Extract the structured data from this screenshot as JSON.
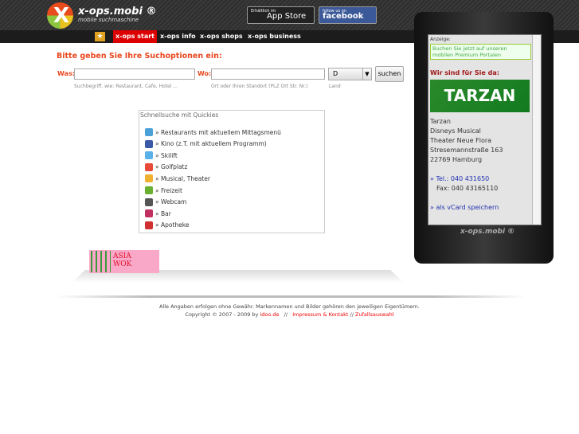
{
  "header": {
    "brand": "x-ops.mobi ®",
    "tagline": "mobile suchmaschine",
    "appstore": "App Store",
    "appstore_small": "Erhältlich im",
    "facebook": "facebook",
    "facebook_small": "follow us on"
  },
  "nav": [
    {
      "label": "x-ops start",
      "active": true
    },
    {
      "label": "x-ops info"
    },
    {
      "label": "x-ops shops"
    },
    {
      "label": "x-ops business"
    }
  ],
  "search": {
    "title": "Bitte geben Sie Ihre Suchoptionen ein:",
    "was_label": "Was:",
    "was_value": "",
    "was_hint": "Suchbegriff, wie: Restaurant, Cafe, Hotel ...",
    "wo_label": "Wo:",
    "wo_value": "",
    "wo_hint": "Ort oder Ihren Standort (PLZ Ort Str. Nr.)",
    "land_value": "D",
    "land_hint": "Land",
    "button": "suchen"
  },
  "quickies": {
    "title": "Schnellsuche mit Quickies",
    "items": [
      {
        "label": "» Restaurants mit aktuellem Mittagsmenü",
        "color": "#4aa0d8"
      },
      {
        "label": "» Kino (z.T. mit aktuellem Programm)",
        "color": "#3a5aa8"
      },
      {
        "label": "» Skilift",
        "color": "#5ab0e8"
      },
      {
        "label": "» Golfplatz",
        "color": "#e84a3a"
      },
      {
        "label": "» Musical, Theater",
        "color": "#f0b030"
      },
      {
        "label": "» Freizeit",
        "color": "#6ab030"
      },
      {
        "label": "» Webcam",
        "color": "#555555"
      },
      {
        "label": "» Bar",
        "color": "#c03060"
      },
      {
        "label": "» Apotheke",
        "color": "#d03030"
      }
    ]
  },
  "ad_banner": {
    "line1": "ASIA",
    "line2": "WOK"
  },
  "footer": {
    "line1": "Alle Angaben erfolgen ohne Gewähr. Markennamen und Bilder gehören den jeweiligen Eigentümern.",
    "copyright": "Copyright © 2007 - 2009 by",
    "link1": "idoo.de",
    "sep": "//",
    "link2": "Impressum & Kontakt",
    "link3": "Zufallsauswahl"
  },
  "phone": {
    "anzeige": "Anzeige:",
    "ad_text": "Buchen Sie jetzt auf unseren mobilen Premium Portalen",
    "heading": "Wir sind für Sie da:",
    "logo_text": "TARZAN",
    "name": "Tarzan",
    "line2": "Disneys Musical",
    "line3": "Theater Neue Flora",
    "street": "Stresemannstraße 163",
    "city": "22769 Hamburg",
    "tel": "» Tel.: 040 431650",
    "fax": "Fax: 040 43165110",
    "vcard": "» als vCard speichern",
    "brand": "x-ops.mobi ®"
  }
}
